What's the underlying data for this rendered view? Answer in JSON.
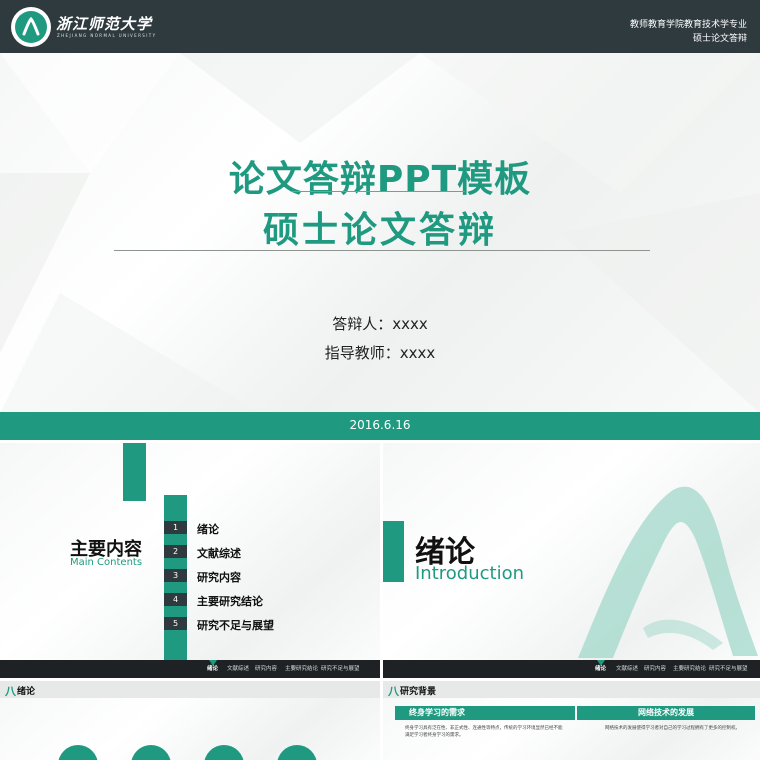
{
  "colors": {
    "accent": "#1f9a80",
    "header": "#2f3a3f",
    "nav": "#1e2224"
  },
  "main_slide": {
    "logo_script": "浙江师范大学",
    "logo_english": "ZHEJIANG NORMAL UNIVERSITY",
    "department": "教师教育学院教育技术学专业",
    "degree": "硕士论文答辩",
    "title_line1": "论文答辩PPT模板",
    "title_line2": "硕士论文答辩",
    "defender": "答辩人：xxxx",
    "advisor": "指导教师：xxxx",
    "date": "2016.6.16"
  },
  "contents_slide": {
    "title": "主要内容",
    "subtitle": "Main Contents",
    "items": [
      {
        "num": "1",
        "label": "绪论"
      },
      {
        "num": "2",
        "label": "文献综述"
      },
      {
        "num": "3",
        "label": "研究内容"
      },
      {
        "num": "4",
        "label": "主要研究结论"
      },
      {
        "num": "5",
        "label": "研究不足与展望"
      }
    ]
  },
  "intro_slide": {
    "title": "绪论",
    "subtitle": "Introduction",
    "brush_icon": "brush-stroke-logo"
  },
  "nav": {
    "items": [
      "绪论",
      "文献综述",
      "研究内容",
      "主要研究结论",
      "研究不足与展望"
    ],
    "active_index": 0
  },
  "bottom_left": {
    "section_icon": "八",
    "section_label": "绪论"
  },
  "bottom_right": {
    "section_icon": "八",
    "section_label": "研究背景",
    "col1_head": "终身学习的需求",
    "col2_head": "网络技术的发展",
    "col1_body": "终身学习具有泛在性、非正式性、连通性等特点，传统的学习环境显然已经不能满足学习者终身学习的需求。",
    "col2_body": "网络技术的发展使得学习者对自己的学习过程拥有了更多的控制权。"
  }
}
